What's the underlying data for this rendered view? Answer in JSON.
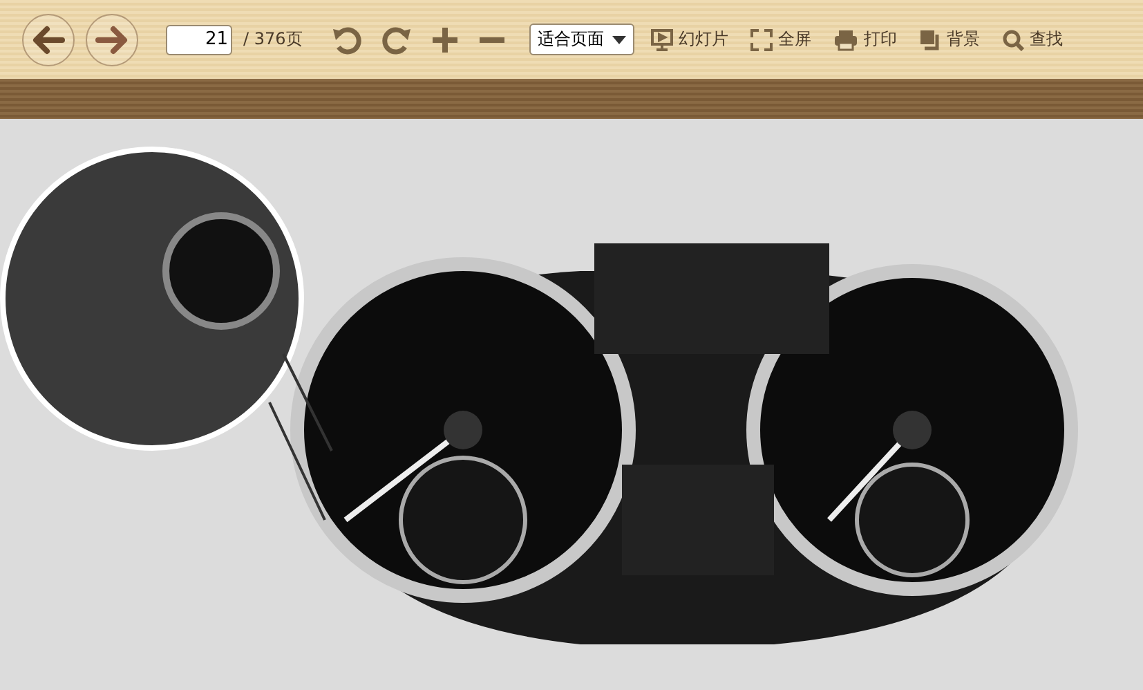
{
  "toolbar": {
    "page_field": {
      "value": "21"
    },
    "page_total": "/ 376页",
    "zoom_select": {
      "value": "适合页面"
    },
    "tools": [
      {
        "kind": "slideshow",
        "label": "幻灯片"
      },
      {
        "kind": "fullscreen",
        "label": "全屏"
      },
      {
        "kind": "print",
        "label": "打印"
      },
      {
        "kind": "background",
        "label": "背景"
      },
      {
        "kind": "search",
        "label": "查找"
      }
    ]
  }
}
